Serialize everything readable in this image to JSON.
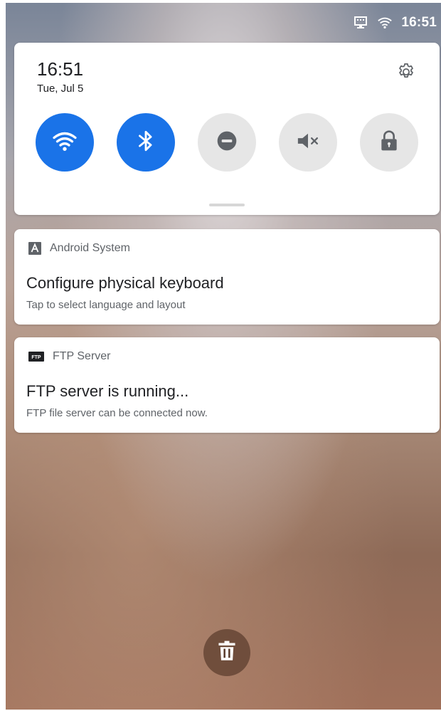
{
  "status_bar": {
    "time": "16:51",
    "icons": [
      "ethernet-icon",
      "wifi-icon"
    ]
  },
  "quick_settings": {
    "time": "16:51",
    "date": "Tue, Jul 5",
    "settings_icon": "gear-icon",
    "tiles": [
      {
        "name": "wifi",
        "icon": "wifi-icon",
        "state": "on"
      },
      {
        "name": "bluetooth",
        "icon": "bluetooth-icon",
        "state": "on"
      },
      {
        "name": "do-not-disturb",
        "icon": "dnd-icon",
        "state": "off"
      },
      {
        "name": "mute",
        "icon": "volume-mute-icon",
        "state": "off"
      },
      {
        "name": "lock",
        "icon": "lock-icon",
        "state": "off"
      }
    ],
    "active_color": "#1a73e8",
    "inactive_color": "#e6e6e6"
  },
  "notifications": [
    {
      "app": "Android System",
      "app_icon": "android-system-icon",
      "title": "Configure physical keyboard",
      "text": "Tap to select language and layout"
    },
    {
      "app": "FTP Server",
      "app_icon": "ftp-icon",
      "app_icon_text": "FTP",
      "title": "FTP server is running...",
      "text": "FTP file server can be connected now."
    }
  ],
  "clear_all": {
    "icon": "trash-icon"
  }
}
